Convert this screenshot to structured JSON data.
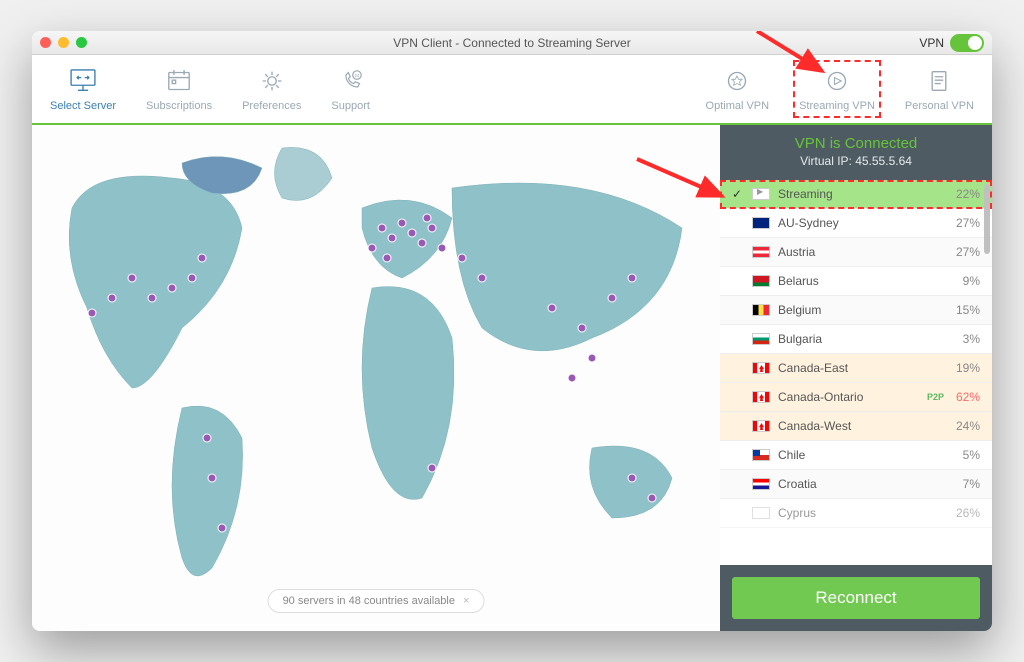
{
  "titlebar": {
    "title": "VPN Client - Connected to Streaming Server",
    "vpn_label": "VPN"
  },
  "toolbar": {
    "select_server": "Select Server",
    "subscriptions": "Subscriptions",
    "preferences": "Preferences",
    "support": "Support",
    "optimal": "Optimal VPN",
    "streaming": "Streaming VPN",
    "personal": "Personal VPN"
  },
  "sidebar": {
    "status": "VPN is Connected",
    "ip_label": "Virtual IP: 45.55.5.64",
    "reconnect": "Reconnect"
  },
  "servers": {
    "items": [
      {
        "name": "Streaming",
        "pct": "22%",
        "selected": true,
        "flag": "stream"
      },
      {
        "name": "AU-Sydney",
        "pct": "27%",
        "flag": "au"
      },
      {
        "name": "Austria",
        "pct": "27%",
        "flag": "at"
      },
      {
        "name": "Belarus",
        "pct": "9%",
        "flag": "by"
      },
      {
        "name": "Belgium",
        "pct": "15%",
        "flag": "be"
      },
      {
        "name": "Bulgaria",
        "pct": "3%",
        "flag": "bg"
      },
      {
        "name": "Canada-East",
        "pct": "19%",
        "flag": "ca"
      },
      {
        "name": "Canada-Ontario",
        "pct": "62%",
        "flag": "ca",
        "badge": "P2P",
        "high": true
      },
      {
        "name": "Canada-West",
        "pct": "24%",
        "flag": "ca"
      },
      {
        "name": "Chile",
        "pct": "5%",
        "flag": "cl"
      },
      {
        "name": "Croatia",
        "pct": "7%",
        "flag": "hr"
      },
      {
        "name": "Cyprus",
        "pct": "26%",
        "flag": "cy"
      }
    ]
  },
  "map": {
    "status_text": "90 servers in 48 countries available"
  }
}
